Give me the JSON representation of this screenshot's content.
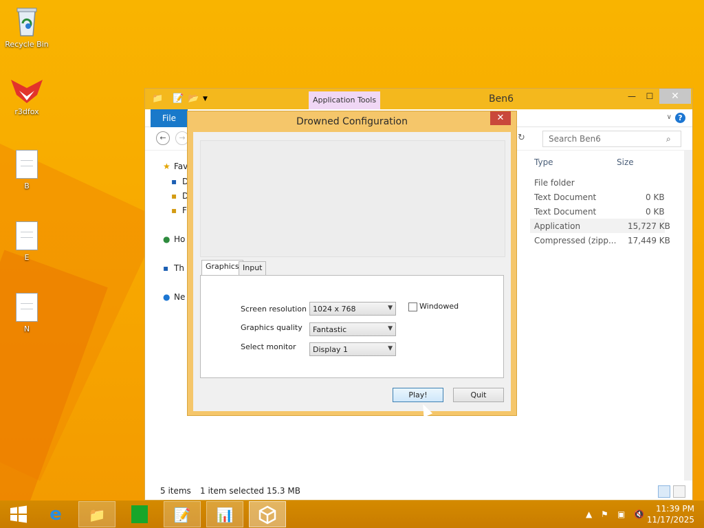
{
  "desktop": {
    "icons": [
      {
        "label": "Recycle Bin",
        "icon": "recycle-bin-icon"
      },
      {
        "label": "r3dfox",
        "icon": "fox-icon"
      },
      {
        "label": "B",
        "icon": "text-file-icon"
      },
      {
        "label": "E",
        "icon": "text-file-icon"
      },
      {
        "label": "N",
        "icon": "text-file-icon"
      }
    ]
  },
  "explorer": {
    "title": "Ben6",
    "context_tab": "Application Tools",
    "file_tab": "File",
    "search_placeholder": "Search Ben6",
    "nav": [
      "Fav",
      "D",
      "D",
      "F",
      "Ho",
      "Th",
      "Ne"
    ],
    "columns": {
      "type": "Type",
      "size": "Size"
    },
    "rows": [
      {
        "type": "File folder",
        "size": ""
      },
      {
        "type": "Text Document",
        "size": "0 KB"
      },
      {
        "type": "Text Document",
        "size": "0 KB"
      },
      {
        "type": "Application",
        "size": "15,727 KB"
      },
      {
        "type": "Compressed (zipp...",
        "size": "17,449 KB"
      }
    ],
    "status": {
      "items": "5 items",
      "selected": "1 item selected  15.3 MB"
    }
  },
  "config": {
    "title": "Drowned Configuration",
    "tabs": [
      "Graphics",
      "Input"
    ],
    "fields": {
      "resolution_label": "Screen resolution",
      "resolution_value": "1024 x 768",
      "quality_label": "Graphics quality",
      "quality_value": "Fantastic",
      "monitor_label": "Select monitor",
      "monitor_value": "Display 1",
      "windowed_label": "Windowed"
    },
    "buttons": {
      "play": "Play!",
      "quit": "Quit"
    }
  },
  "taskbar": {
    "time": "11:39 PM",
    "date": "11/17/2025"
  },
  "colors": {
    "desktop": "#f7a600",
    "accent": "#f4b81d",
    "file_tab": "#1979ca",
    "close": "#c9483b"
  }
}
